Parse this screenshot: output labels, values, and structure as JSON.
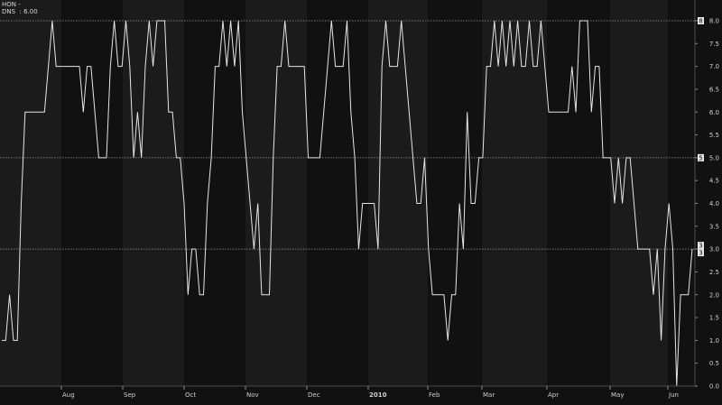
{
  "header": {
    "symbol": "HON -",
    "indicator": "DNS  : 6.00"
  },
  "colors": {
    "background": "#111111",
    "band_alt": "#1b1b1b",
    "line": "#e6e6e6",
    "axis_text": "#d0d0d0",
    "ref_line": "#9a9a9a"
  },
  "chart_data": {
    "type": "line",
    "title": "",
    "xlabel": "",
    "ylabel": "",
    "ylim": [
      0.0,
      8.0
    ],
    "y_ticks": [
      "0.0",
      "0.5",
      "1.0",
      "1.5",
      "2.0",
      "2.5",
      "3.0",
      "3.5",
      "4.0",
      "4.5",
      "5.0",
      "5.5",
      "6.0",
      "6.5",
      "7.0",
      "7.5",
      "8.0"
    ],
    "x_month_labels": [
      "Aug",
      "Sep",
      "Oct",
      "Nov",
      "Dec",
      "2010",
      "Feb",
      "Mar",
      "Apr",
      "May",
      "Jun"
    ],
    "reference_lines": [
      {
        "value": 8,
        "label": "8"
      },
      {
        "value": 5,
        "label": "5"
      },
      {
        "value": 3,
        "label": "3"
      }
    ],
    "last_value_label": "3",
    "grid": false,
    "series": [
      {
        "values": [
          1,
          1,
          2,
          1,
          1,
          4,
          6,
          6,
          6,
          6,
          6,
          6,
          7,
          8,
          7,
          7,
          7,
          7,
          7,
          7,
          7,
          6,
          7,
          7,
          6,
          5,
          5,
          5,
          7,
          8,
          7,
          7,
          8,
          7,
          5,
          6,
          5,
          7,
          8,
          7,
          8,
          8,
          8,
          6,
          6,
          5,
          5,
          4,
          2,
          3,
          3,
          2,
          2,
          4,
          5,
          7,
          7,
          8,
          7,
          8,
          7,
          8,
          6,
          5,
          4,
          3,
          4,
          2,
          2,
          2,
          5,
          7,
          7,
          8,
          7,
          7,
          7,
          7,
          7,
          5,
          5,
          5,
          5,
          6,
          7,
          8,
          7,
          7,
          7,
          8,
          6,
          5,
          3,
          4,
          4,
          4,
          4,
          3,
          7,
          8,
          7,
          7,
          7,
          8,
          7,
          6,
          5,
          4,
          4,
          5,
          3,
          2,
          2,
          2,
          2,
          1,
          2,
          2,
          4,
          3,
          6,
          4,
          4,
          5,
          5,
          7,
          7,
          8,
          7,
          8,
          7,
          8,
          7,
          8,
          7,
          7,
          8,
          7,
          7,
          8,
          7,
          6,
          6,
          6,
          6,
          6,
          6,
          7,
          6,
          8,
          8,
          8,
          6,
          7,
          7,
          5,
          5,
          5,
          4,
          5,
          4,
          5,
          5,
          4,
          3,
          3,
          3,
          3,
          2,
          3,
          1,
          3,
          4,
          3,
          0,
          2,
          2,
          2,
          3
        ]
      }
    ]
  }
}
